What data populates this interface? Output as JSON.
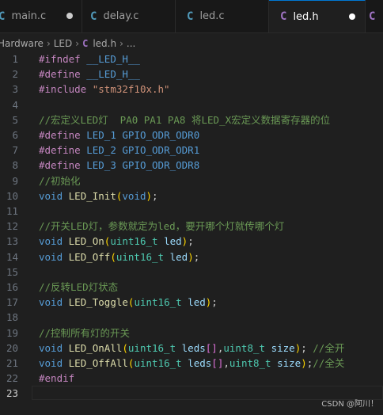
{
  "tabs": [
    {
      "icon": "C",
      "label": "main.c",
      "modified": true
    },
    {
      "icon": "C",
      "label": "delay.c",
      "modified": false
    },
    {
      "icon": "C",
      "label": "led.c",
      "modified": false
    },
    {
      "icon": "C",
      "label": "led.h",
      "modified": true,
      "active": true
    },
    {
      "icon": "C",
      "label": "",
      "modified": false
    }
  ],
  "breadcrumb": {
    "folder1": "Hardware",
    "folder2": "LED",
    "file": "led.h",
    "more": "..."
  },
  "editor": {
    "line_numbers": [
      "1",
      "2",
      "3",
      "4",
      "5",
      "6",
      "7",
      "8",
      "9",
      "10",
      "11",
      "12",
      "13",
      "14",
      "15",
      "16",
      "17",
      "18",
      "19",
      "20",
      "21",
      "22",
      "23"
    ],
    "lines": [
      {
        "tokens": [
          [
            "#ifndef",
            "pp"
          ],
          [
            " ",
            ""
          ],
          [
            "__LED_H__",
            "macro"
          ]
        ]
      },
      {
        "tokens": [
          [
            "#define",
            "pp"
          ],
          [
            " ",
            ""
          ],
          [
            "__LED_H__",
            "macro"
          ]
        ]
      },
      {
        "tokens": [
          [
            "#include",
            "pp"
          ],
          [
            " ",
            ""
          ],
          [
            "\"stm32f10x.h\"",
            "str"
          ]
        ]
      },
      {
        "tokens": []
      },
      {
        "tokens": [
          [
            "//宏定义LED灯  PA0 PA1 PA8 将LED_X宏定义数据寄存器的位",
            "com"
          ]
        ]
      },
      {
        "tokens": [
          [
            "#define",
            "pp"
          ],
          [
            " ",
            ""
          ],
          [
            "LED_1",
            "macro"
          ],
          [
            " ",
            ""
          ],
          [
            "GPIO_ODR_ODR0",
            "macro"
          ]
        ]
      },
      {
        "tokens": [
          [
            "#define",
            "pp"
          ],
          [
            " ",
            ""
          ],
          [
            "LED_2",
            "macro"
          ],
          [
            " ",
            ""
          ],
          [
            "GPIO_ODR_ODR1",
            "macro"
          ]
        ]
      },
      {
        "tokens": [
          [
            "#define",
            "pp"
          ],
          [
            " ",
            ""
          ],
          [
            "LED_3",
            "macro"
          ],
          [
            " ",
            ""
          ],
          [
            "GPIO_ODR_ODR8",
            "macro"
          ]
        ]
      },
      {
        "tokens": [
          [
            "//初始化",
            "com"
          ]
        ]
      },
      {
        "tokens": [
          [
            "void",
            "type"
          ],
          [
            " ",
            ""
          ],
          [
            "LED_Init",
            "fn"
          ],
          [
            "(",
            "p1"
          ],
          [
            "void",
            "type"
          ],
          [
            ")",
            "p1"
          ],
          [
            ";",
            ""
          ]
        ]
      },
      {
        "tokens": []
      },
      {
        "tokens": [
          [
            "//开关LED灯，参数就定为led，要开哪个灯就传哪个灯",
            "com"
          ]
        ]
      },
      {
        "tokens": [
          [
            "void",
            "type"
          ],
          [
            " ",
            ""
          ],
          [
            "LED_On",
            "fn"
          ],
          [
            "(",
            "p1"
          ],
          [
            "uint16_t",
            "type2"
          ],
          [
            " ",
            ""
          ],
          [
            "led",
            "var"
          ],
          [
            ")",
            "p1"
          ],
          [
            ";",
            ""
          ]
        ]
      },
      {
        "tokens": [
          [
            "void",
            "type"
          ],
          [
            " ",
            ""
          ],
          [
            "LED_Off",
            "fn"
          ],
          [
            "(",
            "p1"
          ],
          [
            "uint16_t",
            "type2"
          ],
          [
            " ",
            ""
          ],
          [
            "led",
            "var"
          ],
          [
            ")",
            "p1"
          ],
          [
            ";",
            ""
          ]
        ]
      },
      {
        "tokens": []
      },
      {
        "tokens": [
          [
            "//反转LED灯状态",
            "com"
          ]
        ]
      },
      {
        "tokens": [
          [
            "void",
            "type"
          ],
          [
            " ",
            ""
          ],
          [
            "LED_Toggle",
            "fn"
          ],
          [
            "(",
            "p1"
          ],
          [
            "uint16_t",
            "type2"
          ],
          [
            " ",
            ""
          ],
          [
            "led",
            "var"
          ],
          [
            ")",
            "p1"
          ],
          [
            ";",
            ""
          ]
        ]
      },
      {
        "tokens": []
      },
      {
        "tokens": [
          [
            "//控制所有灯的开关",
            "com"
          ]
        ]
      },
      {
        "tokens": [
          [
            "void",
            "type"
          ],
          [
            " ",
            ""
          ],
          [
            "LED_OnAll",
            "fn"
          ],
          [
            "(",
            "p1"
          ],
          [
            "uint16_t",
            "type2"
          ],
          [
            " ",
            ""
          ],
          [
            "leds",
            "var"
          ],
          [
            "[]",
            "p2"
          ],
          [
            ",",
            ""
          ],
          [
            "uint8_t",
            "type2"
          ],
          [
            " ",
            ""
          ],
          [
            "size",
            "var"
          ],
          [
            ")",
            "p1"
          ],
          [
            ";",
            ""
          ],
          [
            " ",
            ""
          ],
          [
            "//全开",
            "com"
          ]
        ]
      },
      {
        "tokens": [
          [
            "void",
            "type"
          ],
          [
            " ",
            ""
          ],
          [
            "LED_OffAll",
            "fn"
          ],
          [
            "(",
            "p1"
          ],
          [
            "uint16_t",
            "type2"
          ],
          [
            " ",
            ""
          ],
          [
            "leds",
            "var"
          ],
          [
            "[]",
            "p2"
          ],
          [
            ",",
            ""
          ],
          [
            "uint8_t",
            "type2"
          ],
          [
            " ",
            ""
          ],
          [
            "size",
            "var"
          ],
          [
            ")",
            "p1"
          ],
          [
            ";",
            ""
          ],
          [
            "//全关",
            "com"
          ]
        ]
      },
      {
        "tokens": [
          [
            "#endif",
            "pp"
          ]
        ]
      },
      {
        "tokens": []
      }
    ],
    "current_line": 23
  },
  "watermark": "CSDN @阿川！",
  "colors": {
    "accent": "#0078d4",
    "c_icon": "#519aba",
    "header_icon": "#a074c4",
    "background": "#1f1f1f"
  }
}
